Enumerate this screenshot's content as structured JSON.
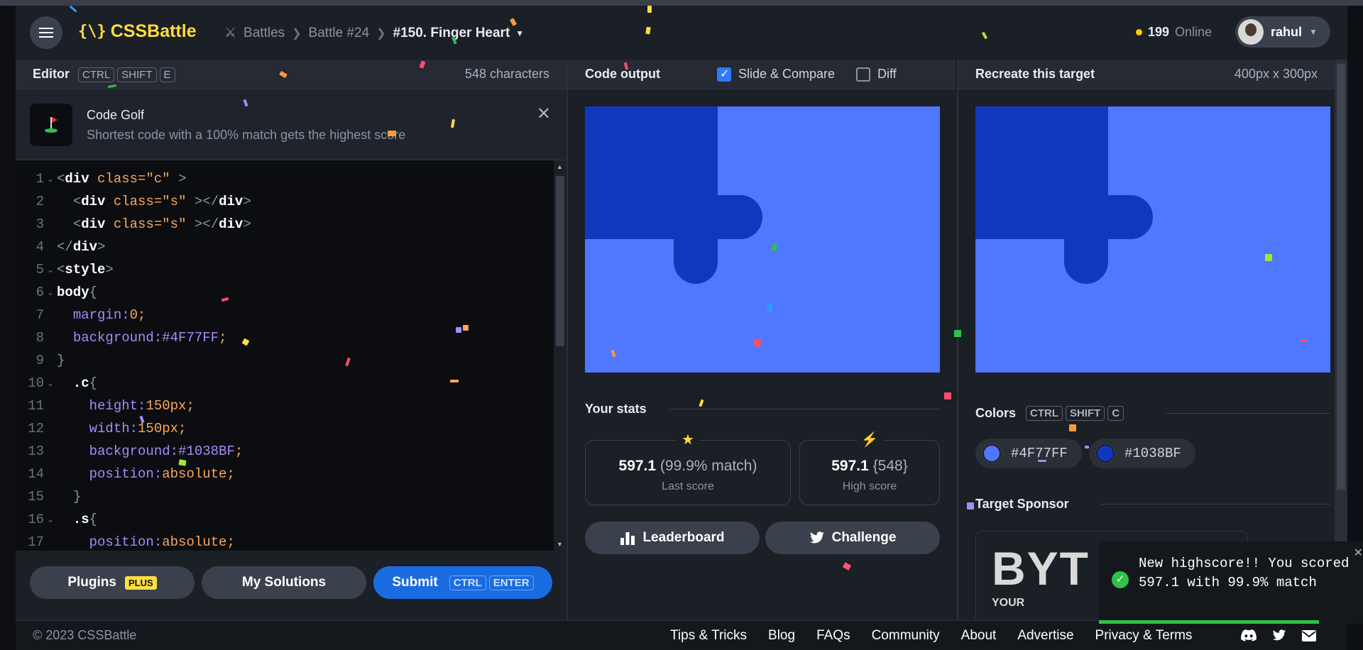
{
  "header": {
    "logo_text": "CSSBattle",
    "logo_mark": "{\\}",
    "breadcrumbs": [
      "Battles",
      "Battle #24"
    ],
    "current": "#150. Finger Heart",
    "online_count": "199",
    "online_label": "Online",
    "username": "rahul"
  },
  "editor": {
    "title": "Editor",
    "shortcut": [
      "CTRL",
      "SHIFT",
      "E"
    ],
    "chars": "548 characters",
    "golf_title": "Code Golf",
    "golf_sub": "Shortest code with a 100% match gets the highest score",
    "lines": [
      {
        "n": "1",
        "fold": true,
        "html": "<span class='tk-punc'>&lt;</span><span class='tk-tag'>div</span> <span class='tk-attr'>class=</span><span class='tk-str'>\"c\"</span> <span class='tk-punc'>&gt;</span>"
      },
      {
        "n": "2",
        "fold": false,
        "html": "  <span class='tk-punc'>&lt;</span><span class='tk-tag'>div</span> <span class='tk-attr'>class=</span><span class='tk-str'>\"s\"</span> <span class='tk-punc'>&gt;&lt;/</span><span class='tk-tag'>div</span><span class='tk-punc'>&gt;</span>"
      },
      {
        "n": "3",
        "fold": false,
        "html": "  <span class='tk-punc'>&lt;</span><span class='tk-tag'>div</span> <span class='tk-attr'>class=</span><span class='tk-str'>\"s\"</span> <span class='tk-punc'>&gt;&lt;/</span><span class='tk-tag'>div</span><span class='tk-punc'>&gt;</span>"
      },
      {
        "n": "4",
        "fold": false,
        "html": "<span class='tk-punc'>&lt;/</span><span class='tk-tag'>div</span><span class='tk-punc'>&gt;</span>"
      },
      {
        "n": "5",
        "fold": true,
        "html": "<span class='tk-punc'>&lt;</span><span class='tk-tag'>style</span><span class='tk-punc'>&gt;</span>"
      },
      {
        "n": "6",
        "fold": true,
        "html": "<span class='tk-tag'>body</span><span class='tk-punc'>{</span>"
      },
      {
        "n": "7",
        "fold": false,
        "html": "  <span class='tk-prop'>margin:</span><span class='tk-val'>0;</span>"
      },
      {
        "n": "8",
        "fold": false,
        "html": "  <span class='tk-prop'>background:</span><span class='tk-hex'>#4F77FF</span><span class='tk-val'>;</span>"
      },
      {
        "n": "9",
        "fold": false,
        "html": "<span class='tk-punc'>}</span>"
      },
      {
        "n": "10",
        "fold": true,
        "html": "  <span class='tk-tag'>.c</span><span class='tk-punc'>{</span>"
      },
      {
        "n": "11",
        "fold": false,
        "html": "    <span class='tk-prop'>height:</span><span class='tk-val'>150px;</span>"
      },
      {
        "n": "12",
        "fold": false,
        "html": "    <span class='tk-prop'>width:</span><span class='tk-val'>150px;</span>"
      },
      {
        "n": "13",
        "fold": false,
        "html": "    <span class='tk-prop'>background:</span><span class='tk-hex'>#1038BF</span><span class='tk-val'>;</span>"
      },
      {
        "n": "14",
        "fold": false,
        "html": "    <span class='tk-prop'>position:</span><span class='tk-val'>absolute;</span>"
      },
      {
        "n": "15",
        "fold": false,
        "html": "  <span class='tk-punc'>}</span>"
      },
      {
        "n": "16",
        "fold": true,
        "html": "  <span class='tk-tag'>.s</span><span class='tk-punc'>{</span>"
      },
      {
        "n": "17",
        "fold": false,
        "html": "    <span class='tk-prop'>position:</span><span class='tk-val'>absolute;</span>"
      }
    ]
  },
  "buttons": {
    "plugins": "Plugins",
    "plugins_badge": "PLUS",
    "solutions": "My Solutions",
    "submit": "Submit",
    "submit_keys": [
      "CTRL",
      "ENTER"
    ]
  },
  "output": {
    "title": "Code output",
    "slide_label": "Slide & Compare",
    "diff_label": "Diff",
    "stats_title": "Your stats",
    "last_score": "597.1",
    "last_match": "(99.9% match)",
    "last_label": "Last score",
    "high_score": "597.1",
    "high_chars": "{548}",
    "high_label": "High score",
    "leaderboard": "Leaderboard",
    "challenge": "Challenge"
  },
  "target": {
    "title": "Recreate this target",
    "size": "400px x 300px",
    "colors_title": "Colors",
    "colors_keys": [
      "CTRL",
      "SHIFT",
      "C"
    ],
    "colors": [
      "#4F77FF",
      "#1038BF"
    ],
    "sponsor_title": "Target Sponsor",
    "sponsor_word": "BYT",
    "sponsor_sub": "YOUR"
  },
  "toast": {
    "message": "New highscore!! You scored 597.1 with 99.9% match"
  },
  "footer": {
    "copyright": "© 2023 CSSBattle",
    "links": [
      "Tips & Tricks",
      "Blog",
      "FAQs",
      "Community",
      "About",
      "Advertise",
      "Privacy & Terms"
    ]
  }
}
